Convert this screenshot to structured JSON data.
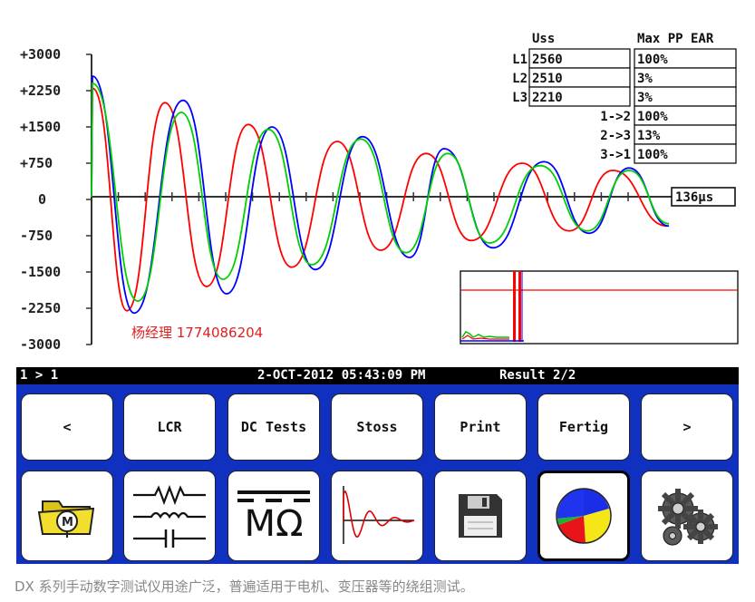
{
  "chart_data": {
    "type": "line",
    "title": "",
    "xlabel": "",
    "ylabel": "",
    "ylim": [
      -3000,
      3000
    ],
    "y_ticks": [
      "+3000",
      "+2250",
      "+1500",
      "+750",
      "0",
      "-750",
      "-1500",
      "-2250",
      "-3000"
    ],
    "x_readout": "136µs",
    "grid": false,
    "series": [
      {
        "name": "L1",
        "color": "#ff0000",
        "peaks": [
          2300,
          -2300,
          2000,
          -1800,
          1550,
          -1400,
          1200,
          -1050,
          950,
          -850,
          750,
          -650,
          600,
          -550
        ]
      },
      {
        "name": "L2",
        "color": "#0000ff",
        "peaks": [
          2550,
          -2350,
          2050,
          -1950,
          1500,
          -1450,
          1300,
          -1200,
          1050,
          -1000,
          780,
          -700,
          650,
          -550
        ]
      },
      {
        "name": "L3",
        "color": "#00d000",
        "peaks": [
          2400,
          -2100,
          1800,
          -1650,
          1450,
          -1350,
          1250,
          -1100,
          950,
          -900,
          700,
          -650,
          600,
          -500
        ]
      }
    ]
  },
  "table": {
    "header_uss": "Uss",
    "header_ear": "Max PP EAR",
    "rows": [
      {
        "label": "L1",
        "label_color": "#ff0000",
        "uss": "2560",
        "ear": "100%"
      },
      {
        "label": "L2",
        "label_color": "#0000ff",
        "uss": "2510",
        "ear": "3%"
      },
      {
        "label": "L3",
        "label_color": "#00c000",
        "uss": "2210",
        "ear": "3%"
      }
    ],
    "pairs": [
      {
        "label": "1->2",
        "value": "100%"
      },
      {
        "label": "2->3",
        "value": "13%"
      },
      {
        "label": "3->1",
        "value": "100%"
      }
    ]
  },
  "watermark": "杨经理 1774086204",
  "status": {
    "left": "1 > 1",
    "datetime": "2-OCT-2012 05:43:09 PM",
    "result": "Result 2/2"
  },
  "buttons_top": [
    {
      "label": "<"
    },
    {
      "label": "LCR"
    },
    {
      "label": "DC Tests"
    },
    {
      "label": "Stoss"
    },
    {
      "label": "Print"
    },
    {
      "label": "Fertig"
    },
    {
      "label": ">"
    }
  ],
  "icons_bottom": [
    {
      "icon": "motor-folder-icon"
    },
    {
      "icon": "components-icon"
    },
    {
      "icon": "dc-ohm-icon",
      "text": "MΩ"
    },
    {
      "icon": "surge-wave-icon"
    },
    {
      "icon": "floppy-disk-icon"
    },
    {
      "icon": "pie-chart-icon"
    },
    {
      "icon": "gears-icon"
    }
  ],
  "caption": "DX 系列手动数字测试仪用途广泛，普遍适用于电机、变压器等的绕组测试。"
}
